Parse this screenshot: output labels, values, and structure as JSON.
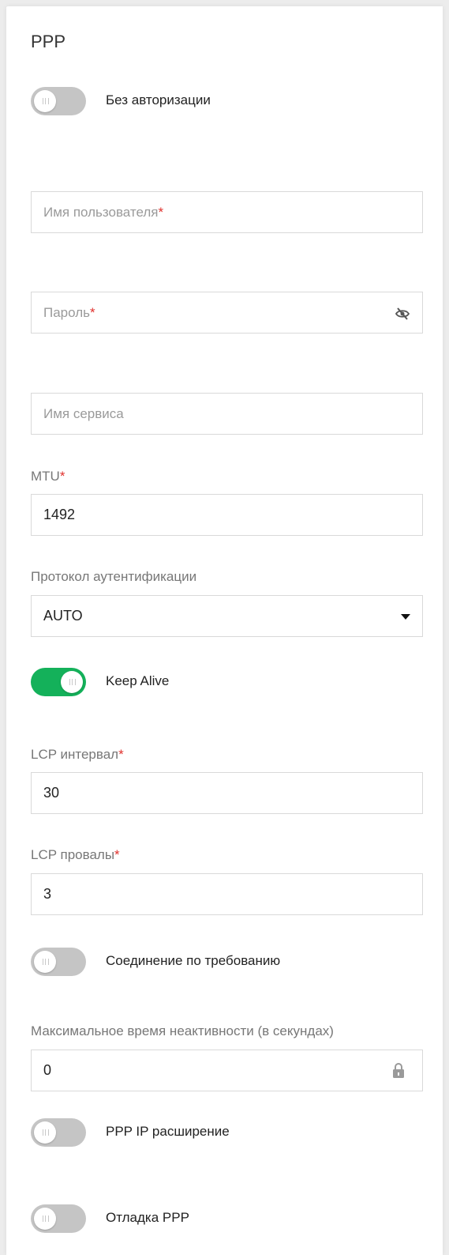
{
  "section": {
    "title": "PPP"
  },
  "no_auth": {
    "label": "Без авторизации",
    "enabled": false
  },
  "username": {
    "placeholder": "Имя пользователя",
    "required_mark": "*",
    "value": ""
  },
  "password": {
    "placeholder": "Пароль",
    "required_mark": "*",
    "value": "",
    "icon": "eye-off-icon"
  },
  "service_name": {
    "placeholder": "Имя сервиса",
    "value": ""
  },
  "mtu": {
    "label": "MTU",
    "required_mark": "*",
    "value": "1492"
  },
  "auth_protocol": {
    "label": "Протокол аутентификации",
    "value": "AUTO"
  },
  "keep_alive": {
    "label": "Keep Alive",
    "enabled": true
  },
  "lcp_interval": {
    "label": "LCP интервал",
    "required_mark": "*",
    "value": "30"
  },
  "lcp_failures": {
    "label": "LCP провалы",
    "required_mark": "*",
    "value": "3"
  },
  "dial_on_demand": {
    "label": "Соединение по требованию",
    "enabled": false
  },
  "idle_timeout": {
    "label": "Максимальное время неактивности (в секундах)",
    "value": "0",
    "icon": "lock-icon"
  },
  "ppp_ip_ext": {
    "label": "PPP IP расширение",
    "enabled": false
  },
  "ppp_debug": {
    "label": "Отладка PPP",
    "enabled": false
  },
  "colors": {
    "toggle_on": "#14b15a",
    "toggle_off": "#c5c5c5",
    "required": "#e0312d"
  }
}
